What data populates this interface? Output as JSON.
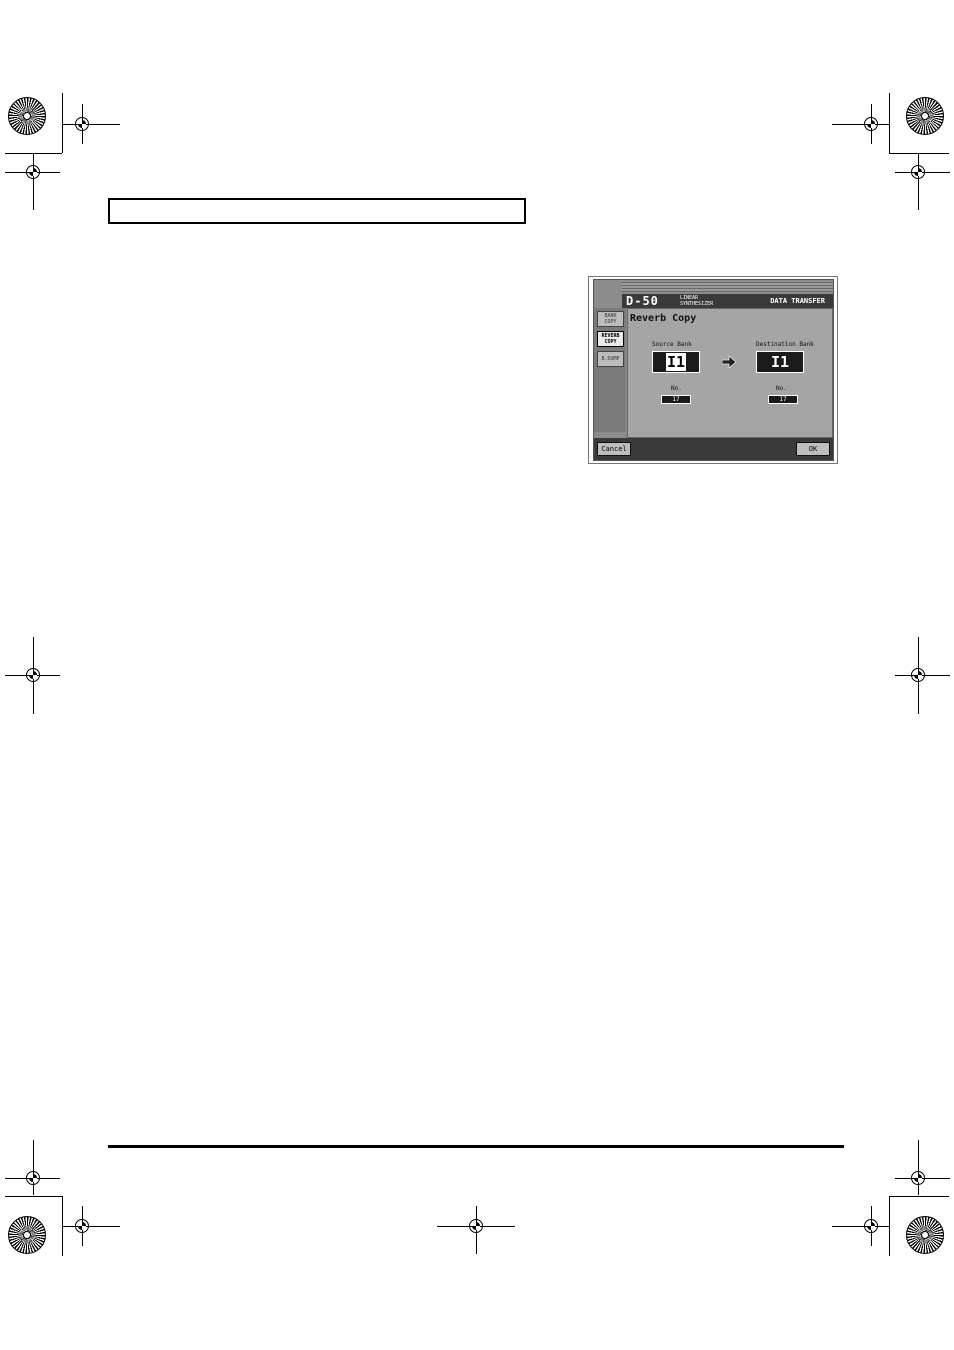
{
  "screen": {
    "logo": "D-50",
    "logo_sub_1": "LINEAR",
    "logo_sub_2": "SYNTHESIZER",
    "mode_title": "DATA TRANSFER",
    "side_buttons": [
      {
        "line1": "BANK",
        "line2": "COPY"
      },
      {
        "line1": "REVERB",
        "line2": "COPY"
      },
      {
        "line1": "B.DUMP",
        "line2": ""
      }
    ],
    "panel_title": "Reverb Copy",
    "source_label": "Source Bank",
    "destination_label": "Destination Bank",
    "source_bank": "I1",
    "destination_bank": "I1",
    "no_label_src": "No.",
    "no_label_dst": "No.",
    "source_no": "17",
    "destination_no": "17",
    "cancel_label": "Cancel",
    "ok_label": "OK"
  }
}
